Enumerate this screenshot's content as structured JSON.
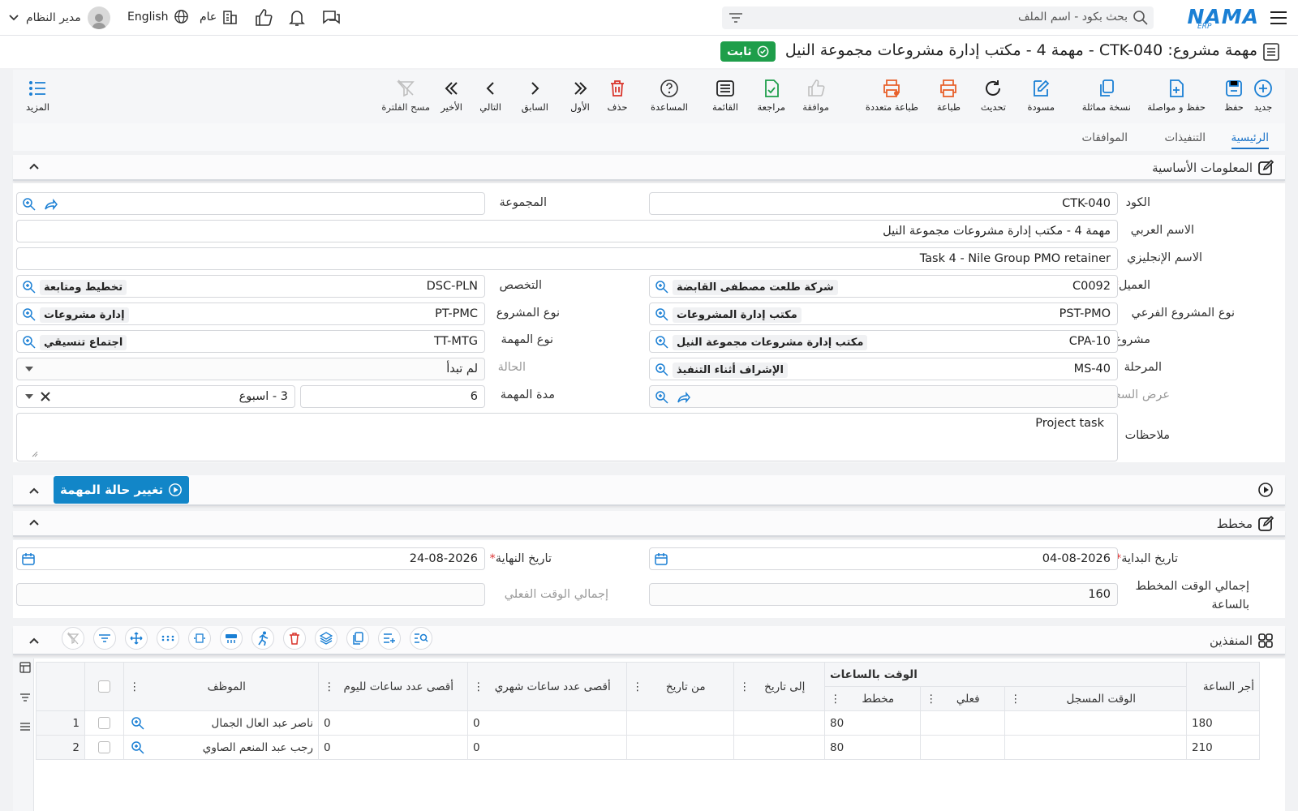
{
  "header": {
    "logo": "NAMA",
    "logo_sub": "ERP",
    "search_placeholder": "بحث بكود - اسم الملف",
    "user_name": "مدير النظام",
    "language": "English",
    "scope": "عام"
  },
  "title": {
    "text": "مهمة مشروع: CTK-040 - مهمة 4 - مكتب إدارة مشروعات مجموعة النيل",
    "status": "ثابت"
  },
  "toolbar": {
    "new": "جديد",
    "save": "حفظ",
    "save_continue": "حفظ و مواصلة",
    "duplicate": "نسخة مماثلة",
    "draft": "مسودة",
    "refresh": "تحديث",
    "print": "طباعة",
    "multi_print": "طباعة متعددة",
    "approve": "موافقة",
    "review": "مراجعة",
    "list": "القائمة",
    "help": "المساعدة",
    "delete": "حذف",
    "first": "الأول",
    "previous": "السابق",
    "next": "التالي",
    "last": "الأخير",
    "clear_filter": "مسح الفلترة",
    "more": "المزيد"
  },
  "tabs": [
    "الرئيسية",
    "التنفيذات",
    "الموافقات"
  ],
  "basic": {
    "title": "المعلومات الأساسية",
    "code_label": "الكود",
    "code": "CTK-040",
    "group_label": "المجموعة",
    "ar_name_label": "الاسم العربي",
    "ar_name": "مهمة 4 - مكتب إدارة مشروعات مجموعة النيل",
    "en_name_label": "الاسم الإنجليزي",
    "en_name": "Task 4 - Nile Group PMO retainer",
    "client_label": "العميل",
    "client_code": "C0092",
    "client_name": "شركة طلعت مصطفى القابضة",
    "specialty_label": "التخصص",
    "specialty_code": "DSC-PLN",
    "specialty_name": "تخطيط ومتابعة",
    "subtype_label": "نوع المشروع الفرعي",
    "subtype_code": "PST-PMO",
    "subtype_name": "مكتب إدارة المشروعات",
    "ptype_label": "نوع المشروع",
    "ptype_code": "PT-PMC",
    "ptype_name": "إدارة مشروعات",
    "project_label": "مشروع",
    "project_code": "CPA-10",
    "project_name": "مكتب إدارة مشروعات مجموعة النيل",
    "ttype_label": "نوع المهمة",
    "ttype_code": "TT-MTG",
    "ttype_name": "اجتماع تنسيقي",
    "phase_label": "المرحلة",
    "phase_code": "MS-40",
    "phase_name": "الإشراف أثناء التنفيذ",
    "state_label": "الحالة",
    "state": "لم تبدأ",
    "quote_label": "عرض السعر",
    "duration_label": "مدة المهمة",
    "duration": "6",
    "duration_unit": "3 - اسبوع",
    "notes_label": "ملاحظات",
    "notes": "Project task"
  },
  "status_section": {
    "button": "تغيير حالة المهمة"
  },
  "plan": {
    "title": "مخطط",
    "start_label": "تاريخ البداية",
    "start": "04-08-2026",
    "end_label": "تاريخ النهاية",
    "end": "24-08-2026",
    "planned_label_1": "إجمالي الوقت المخطط",
    "planned_label_2": "بالساعة",
    "planned": "160",
    "actual_label": "إجمالي الوقت الفعلي"
  },
  "executors": {
    "title": "المنفذين",
    "cols": {
      "employee": "الموظف",
      "max_day": "أقصى عدد ساعات لليوم",
      "max_month": "أقصى عدد ساعات شهري",
      "from": "من تاريخ",
      "to": "إلى تاريخ",
      "hours_group": "الوقت بالساعات",
      "planned": "مخطط",
      "actual": "فعلي",
      "logged": "الوقت المسجل",
      "rate": "أجر الساعة"
    },
    "rows": [
      {
        "n": "1",
        "employee": "ناصر عبد العال الجمال",
        "max_day": "0",
        "max_month": "0",
        "from": "",
        "to": "",
        "planned": "80",
        "actual": "",
        "logged": "",
        "rate": "180"
      },
      {
        "n": "2",
        "employee": "رجب عبد المنعم الصاوي",
        "max_day": "0",
        "max_month": "0",
        "from": "",
        "to": "",
        "planned": "80",
        "actual": "",
        "logged": "",
        "rate": "210"
      }
    ]
  },
  "colors": {
    "accent": "#1a73c8",
    "status_green": "#1e9e4a",
    "toolbar_blue": "#1a7fd4",
    "print_orange": "#e8612c",
    "delete_red": "#d9342b",
    "status_btn": "#1286c8"
  }
}
